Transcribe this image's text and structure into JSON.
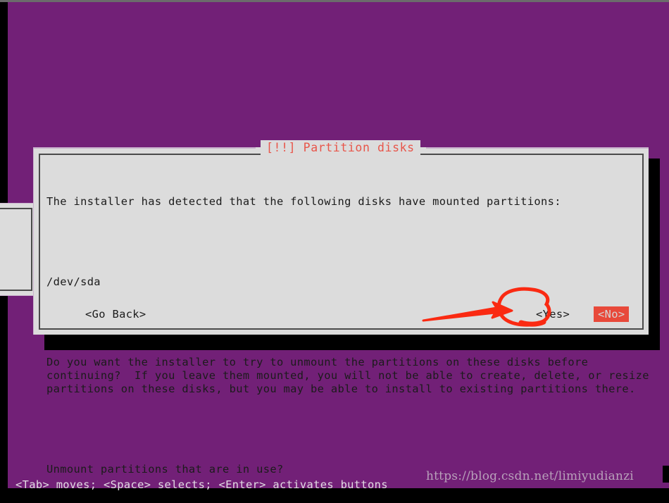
{
  "screen": {
    "background_color": "#722077",
    "shadow_color": "#000000"
  },
  "dialog": {
    "title": "[!!] Partition disks",
    "title_color": "#e8554a",
    "background_color": "#dcdcdc",
    "border_color": "#4a4a4a",
    "paragraphs": [
      "The installer has detected that the following disks have mounted partitions:",
      "/dev/sda",
      "Do you want the installer to try to unmount the partitions on these disks before\ncontinuing?  If you leave them mounted, you will not be able to create, delete, or resize\npartitions on these disks, but you may be able to install to existing partitions there.",
      "Unmount partitions that are in use?"
    ],
    "buttons": {
      "go_back": "<Go Back>",
      "yes": "<Yes>",
      "no": "<No>",
      "selected": "<No>",
      "selected_background_color": "#e8493a",
      "selected_text_color": "#d6d6d6"
    }
  },
  "annotation": {
    "color": "#fa2a12",
    "arrow_label": "arrow-pointing-to-yes",
    "circle_label": "circle-around-yes"
  },
  "status_bar": {
    "help_text": "<Tab> moves; <Space> selects; <Enter> activates buttons"
  },
  "watermark": {
    "text": "https://blog.csdn.net/limiyudianzi",
    "color": "#b8a0ba"
  }
}
